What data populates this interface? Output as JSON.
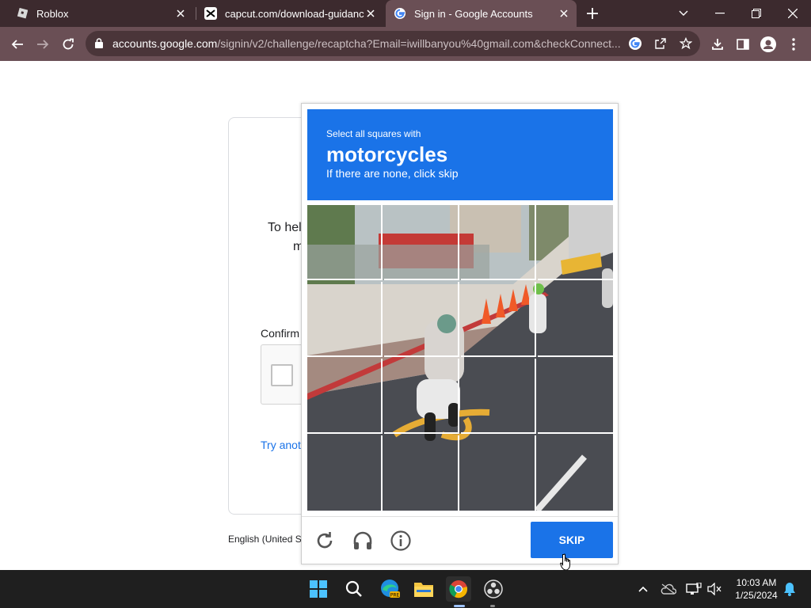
{
  "tabs": [
    {
      "title": "Roblox",
      "icon": "roblox-icon"
    },
    {
      "title": "capcut.com/download-guidance",
      "icon": "capcut-icon"
    },
    {
      "title": "Sign in - Google Accounts",
      "icon": "google-icon",
      "active": true
    }
  ],
  "address": {
    "host": "accounts.google.com",
    "path": "/signin/v2/challenge/recaptcha?Email=iwillbanyou%40gmail.com&checkConnect..."
  },
  "page": {
    "line1_fragment": "To hel",
    "line2_fragment": "m",
    "confirm_label": "Confirm",
    "try_link": "Try anot",
    "language": "English (United S"
  },
  "challenge": {
    "instruction": "Select all squares with",
    "target": "motorcycles",
    "subtext": "If there are none, click skip",
    "skip_label": "SKIP",
    "footer_icons": [
      "reload-icon",
      "audio-headphones-icon",
      "info-icon"
    ]
  },
  "taskbar": {
    "apps": [
      "windows-start-icon",
      "search-icon",
      "edge-preview-icon",
      "file-explorer-icon",
      "chrome-icon",
      "obs-icon"
    ],
    "time": "10:03 AM",
    "date": "1/25/2024"
  },
  "colors": {
    "tab_strip": "#3c2a2e",
    "toolbar": "#6a4f55",
    "challenge_blue": "#1a73e8",
    "taskbar": "#1f1f1f"
  }
}
